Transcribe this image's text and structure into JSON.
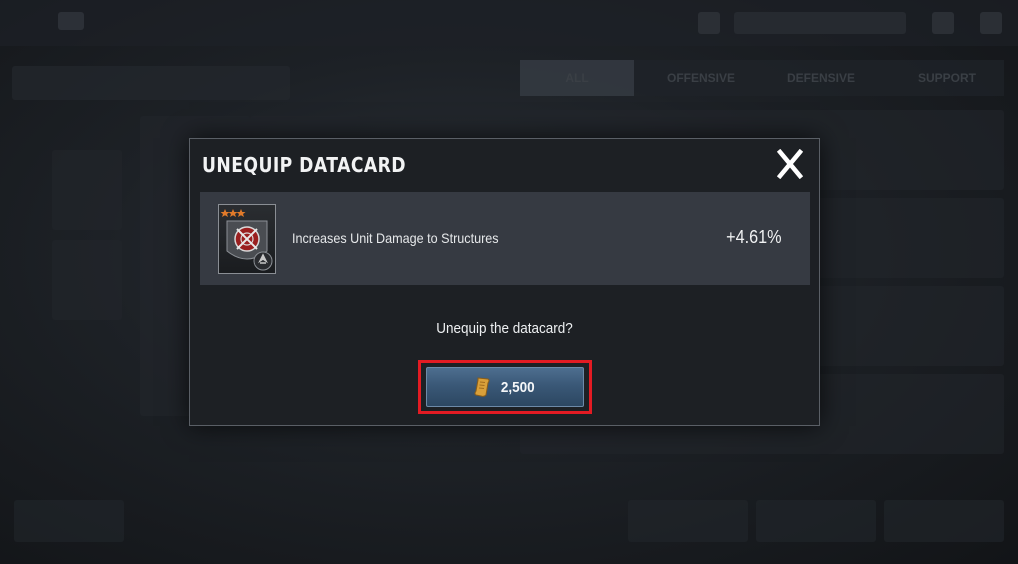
{
  "background": {
    "tabs": [
      {
        "label": "ALL"
      },
      {
        "label": "OFFENSIVE"
      },
      {
        "label": "DEFENSIVE"
      },
      {
        "label": "SUPPORT"
      }
    ]
  },
  "modal": {
    "title": "UNEQUIP DATACARD",
    "close_label": "X",
    "datacard": {
      "stars": 3,
      "icon": "target-crosshair-icon",
      "description": "Increases Unit Damage to Structures",
      "value": "+4.61%"
    },
    "confirm_text": "Unequip the datacard?",
    "cost_button": {
      "icon": "resource-scroll-icon",
      "amount": "2,500"
    }
  },
  "colors": {
    "modal_bg": "#1d2024",
    "card_row_bg": "#363a42",
    "button_blue": "#3a5877",
    "highlight_red": "#e31b23",
    "star_orange": "#e07a2a",
    "resource_gold": "#d9a03a"
  }
}
